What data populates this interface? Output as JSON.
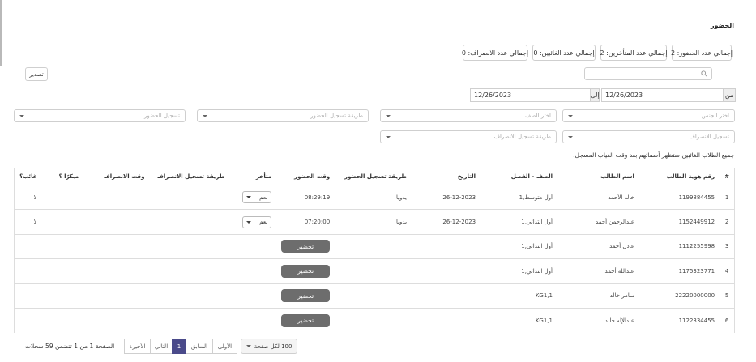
{
  "page_title": "الحضور",
  "stats": {
    "attendance": "إجمالي عدد الحضور: 2",
    "late": "إجمالي عدد المتأخرين: 2",
    "absent": "إجمالي عدد الغائبين: 0",
    "departure": "إجمالي عدد الانصراف: 0"
  },
  "export_label": "تصدير",
  "search": {
    "placeholder": "",
    "value": ""
  },
  "date_from": {
    "label": "من",
    "value": "12/26/2023"
  },
  "date_to": {
    "label": "إلى",
    "value": "12/26/2023"
  },
  "filters": {
    "gender": "اختر الجنس",
    "grade": "اختر الصف",
    "checkin_method": "طريقة تسجيل الحضور",
    "attendance_reg": "تسجيل الحضور",
    "departure_reg": "تسجيل الانصراف",
    "departure_method": "طريقة تسجيل الانصراف"
  },
  "note": "جميع الطلاب الغائبين ستظهر أسمائهم بعد وقت الغياب المسجل.",
  "table": {
    "headers": {
      "num": "#",
      "id": "رقم هوية الطالب",
      "name": "اسم الطالب",
      "grade": "الصف - الفصل",
      "date": "التاريخ",
      "method": "طريقة تسجيل الحضور",
      "time": "وقت الحضور",
      "late": "متأخر",
      "dep_method": "طريقة تسجيل الانصراف",
      "dep_time": "وقت الانصراف",
      "early": "مبكرًا ؟",
      "absent": "غائب؟"
    },
    "rows": [
      {
        "num": "1",
        "id": "1199884455",
        "name": "خالد الأحمد",
        "grade": "أول متوسط,1",
        "date": "26-12-2023",
        "method": "يدويا",
        "time": "08:29:19",
        "late": "نعم",
        "absent": "لا"
      },
      {
        "num": "2",
        "id": "1152449912",
        "name": "عبدالرحمن أحمد",
        "grade": "أول ابتدائي,1",
        "date": "26-12-2023",
        "method": "يدويا",
        "time": "07:20:00",
        "late": "نعم",
        "absent": "لا"
      },
      {
        "num": "3",
        "id": "1112255998",
        "name": "عادل أحمد",
        "grade": "أول ابتدائي,1",
        "action": "تحضير"
      },
      {
        "num": "4",
        "id": "1175323771",
        "name": "عبدالله أحمد",
        "grade": "أول ابتدائي,1",
        "action": "تحضير"
      },
      {
        "num": "5",
        "id": "22220000000",
        "name": "سامر خالد",
        "grade": "KG1,1",
        "action": "تحضير"
      },
      {
        "num": "6",
        "id": "1122334455",
        "name": "عبدالإله خالد",
        "grade": "KG1,1",
        "action": "تحضير"
      }
    ]
  },
  "pagination": {
    "first": "الأولى",
    "prev": "السابق",
    "current": "1",
    "next": "التالي",
    "last": "الأخيرة",
    "per_page": "100 لكل صفحة",
    "info": "الصفحة 1 من 1 تتضمن 59 سجلات"
  }
}
